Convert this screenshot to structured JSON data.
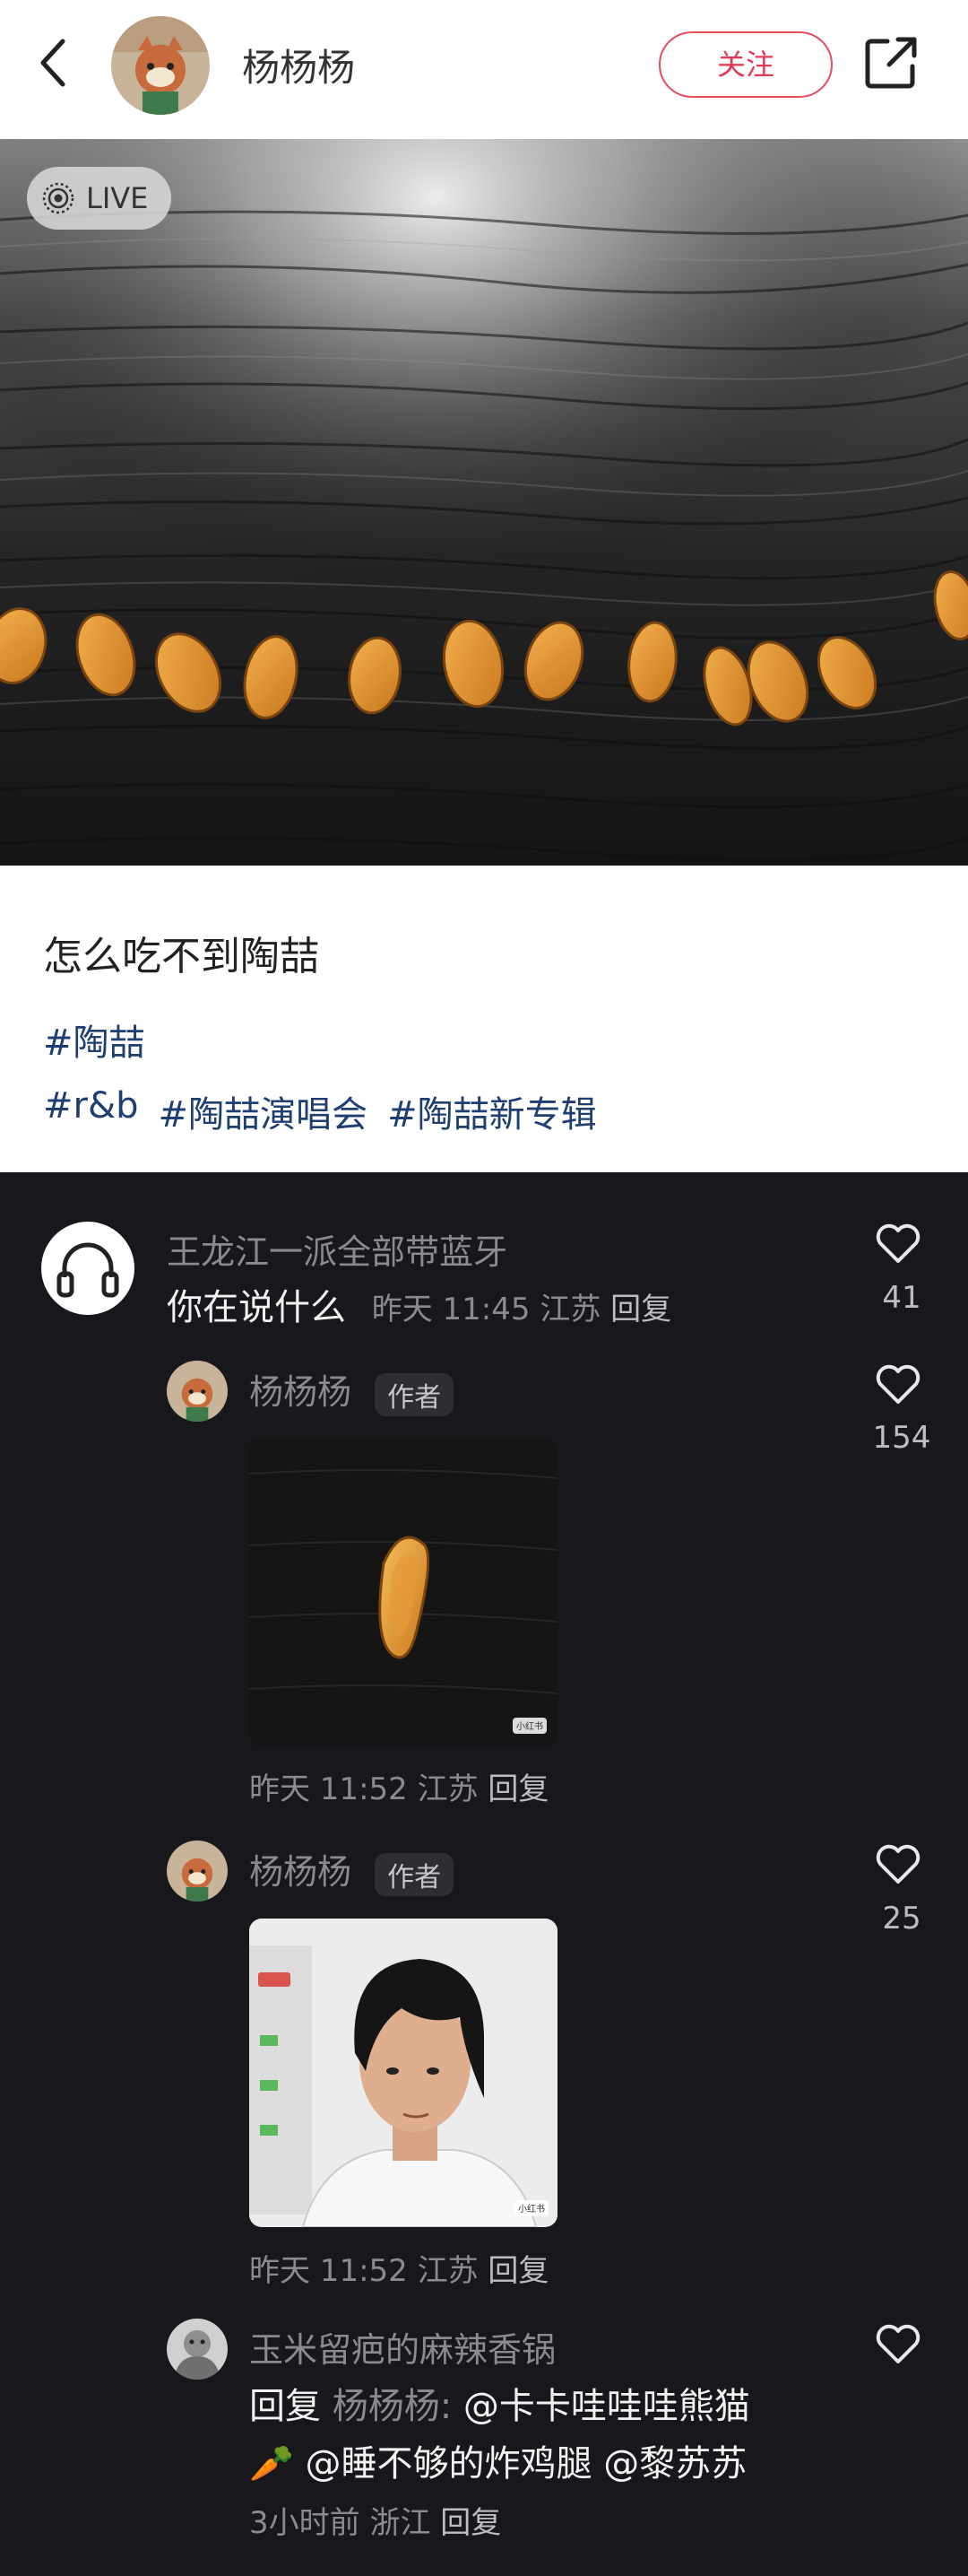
{
  "header": {
    "author": "杨杨杨",
    "follow_label": "关注"
  },
  "photo": {
    "live_label": "LIVE"
  },
  "post": {
    "title": "怎么吃不到陶喆",
    "tags_row1": [
      "#陶喆"
    ],
    "tags_row2": [
      "#r&b",
      "#陶喆演唱会",
      "#陶喆新专辑"
    ]
  },
  "comments": [
    {
      "name": "王龙江一派全部带蓝牙",
      "text": "你在说什么",
      "time": "昨天 11:45",
      "location": "江苏",
      "reply_label": "回复",
      "likes": "41",
      "avatar_icon": "headphones-icon"
    }
  ],
  "replies": [
    {
      "name": "杨杨杨",
      "badge": "作者",
      "time": "昨天 11:52",
      "location": "江苏",
      "reply_label": "回复",
      "likes": "154",
      "image_caption": "小红书"
    },
    {
      "name": "杨杨杨",
      "badge": "作者",
      "time": "昨天 11:52",
      "location": "江苏",
      "reply_label": "回复",
      "likes": "25",
      "image_caption": "小红书"
    },
    {
      "name": "玉米留疤的麻辣香锅",
      "reply_prefix": "回复",
      "reply_to": "杨杨杨:",
      "line1_mention": "@卡卡哇哇哇熊猫",
      "line2": "@睡不够的炸鸡腿 @黎苏苏",
      "emoji": "🥕",
      "time": "3小时前",
      "location": "浙江",
      "reply_label": "回复"
    }
  ],
  "colors": {
    "follow": "#e23a55",
    "tag": "#1f3f73",
    "comment_bg": "#17171c"
  }
}
